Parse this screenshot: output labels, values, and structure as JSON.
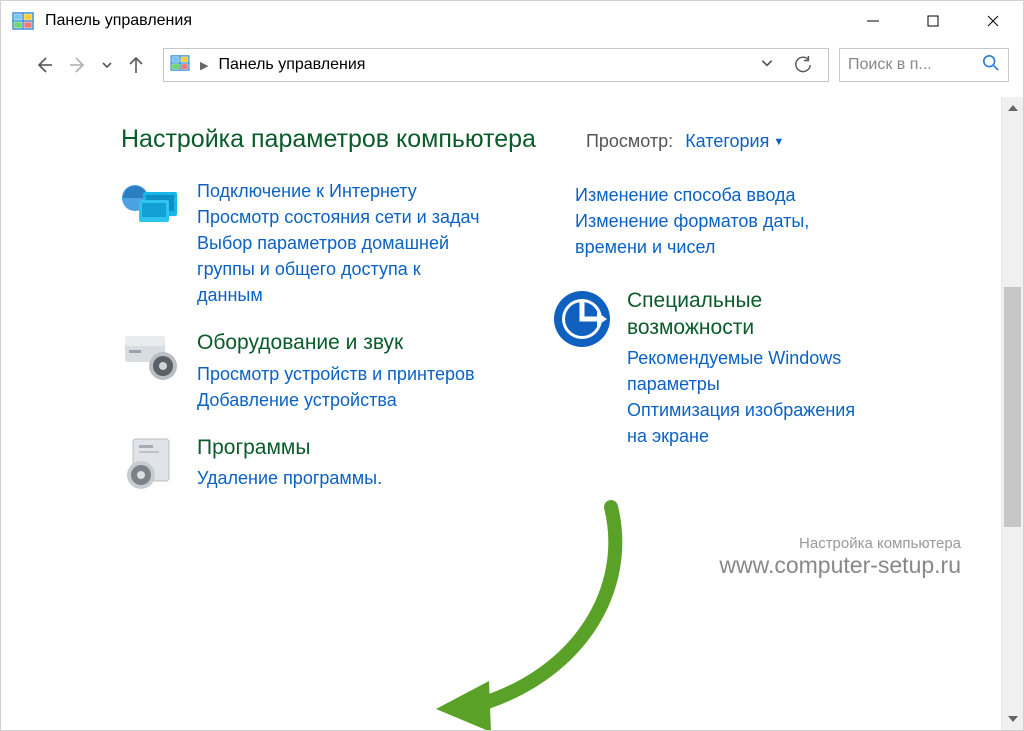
{
  "window": {
    "title": "Панель управления"
  },
  "nav": {
    "breadcrumb": "Панель управления",
    "search_placeholder": "Поиск в п..."
  },
  "page": {
    "heading": "Настройка параметров компьютера",
    "view_label": "Просмотр:",
    "view_value": "Категория"
  },
  "left_column": [
    {
      "title_partial": "",
      "links": [
        "Подключение к Интернету",
        "Просмотр состояния сети и задач",
        "Выбор параметров домашней группы и общего доступа к данным"
      ],
      "icon": "network"
    },
    {
      "title": "Оборудование и звук",
      "links": [
        "Просмотр устройств и принтеров",
        "Добавление устройства"
      ],
      "icon": "hardware"
    },
    {
      "title": "Программы",
      "links": [
        "Удаление программы."
      ],
      "icon": "programs"
    }
  ],
  "right_column": [
    {
      "links": [
        "Изменение способа ввода",
        "Изменение форматов даты, времени и чисел"
      ]
    },
    {
      "title": "Специальные возможности",
      "links": [
        "Рекомендуемые Windows параметры",
        "Оптимизация изображения на экране"
      ],
      "icon": "ease"
    }
  ],
  "watermark": {
    "line1": "Настройка компьютера",
    "line2": "www.computer-setup.ru"
  }
}
